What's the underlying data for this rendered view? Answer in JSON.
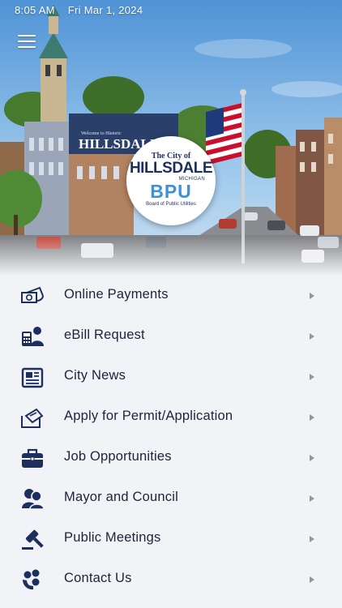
{
  "status_bar": {
    "time": "8:05 AM",
    "date": "Fri Mar 1, 2024"
  },
  "header": {
    "menu_icon": "hamburger-menu-icon",
    "sign_text": "HILLSDALE",
    "sign_small_text": "Welcome to Historic"
  },
  "logo": {
    "line1": "The City of",
    "line2": "HILLSDALE",
    "line3": "MICHIGAN",
    "line4": "BPU",
    "line5": "Board of Public Utilities"
  },
  "colors": {
    "navy": "#1d2f5e",
    "light_blue": "#3f90d4",
    "menu_background": "#f1f3f6",
    "chevron": "#8e96a4"
  },
  "menu": {
    "items": [
      {
        "label": "Online Payments",
        "icon": "payment-icon"
      },
      {
        "label": "eBill Request",
        "icon": "ebill-icon"
      },
      {
        "label": "City News",
        "icon": "newspaper-icon"
      },
      {
        "label": "Apply for Permit/Application",
        "icon": "permit-icon"
      },
      {
        "label": "Job Opportunities",
        "icon": "briefcase-icon"
      },
      {
        "label": "Mayor and Council",
        "icon": "people-icon"
      },
      {
        "label": "Public Meetings",
        "icon": "gavel-icon"
      },
      {
        "label": "Contact Us",
        "icon": "contact-icon"
      }
    ]
  }
}
